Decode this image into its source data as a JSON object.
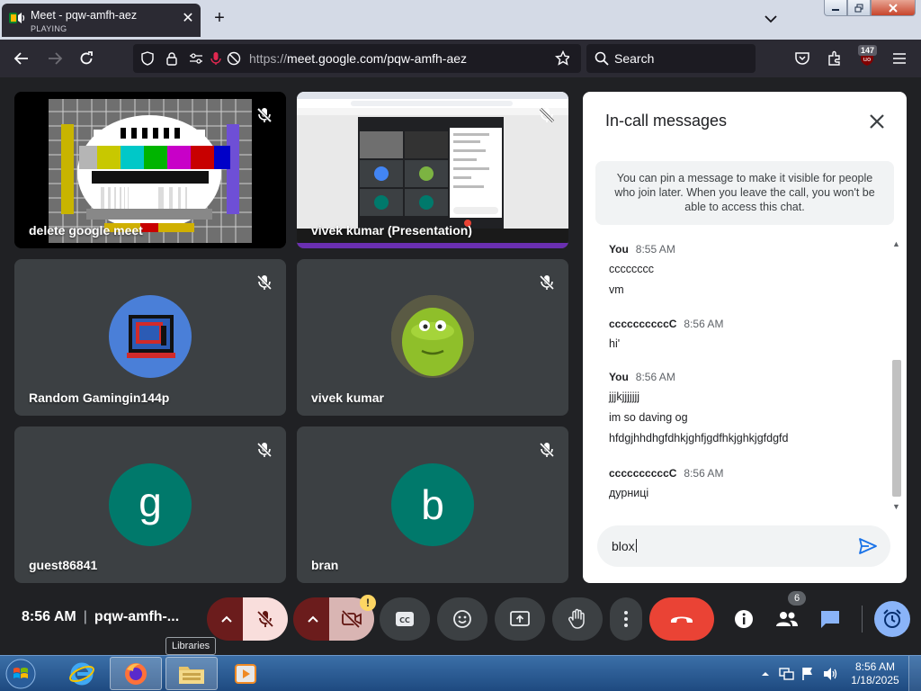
{
  "browser": {
    "tab": {
      "title": "Meet - pqw-amfh-aez",
      "subtitle": "PLAYING",
      "close_glyph": "✕"
    },
    "new_tab_glyph": "+",
    "url": {
      "prefix": "https://",
      "host_path": "meet.google.com/pqw-amfh-aez"
    },
    "search": {
      "placeholder": "Search"
    },
    "extension_badge": "147"
  },
  "tiles": [
    {
      "name": "delete google meet"
    },
    {
      "name": "vivek kumar (Presentation)"
    },
    {
      "name": "Random Gamingin144p"
    },
    {
      "name": "vivek kumar"
    },
    {
      "name": "guest86841",
      "initial": "g"
    },
    {
      "name": "bran",
      "initial": "b"
    }
  ],
  "chat": {
    "title": "In-call messages",
    "pin_note": "You can pin a message to make it visible for people who join later. When you leave the call, you won't be able to access this chat.",
    "groups": [
      {
        "sender": "You",
        "time": "8:55 AM",
        "lines": [
          "cccccccc",
          "vm"
        ]
      },
      {
        "sender": "ccccccccccC",
        "time": "8:56 AM",
        "lines": [
          "hi'"
        ]
      },
      {
        "sender": "You",
        "time": "8:56 AM",
        "lines": [
          "jjjkjjjjjjj",
          "im so daving og",
          "hfdgjhhdhgfdhkjghfjgdfhkjghkjgfdgfd"
        ]
      },
      {
        "sender": "ccccccccccC",
        "time": "8:56 AM",
        "lines": [
          "дурниці"
        ]
      }
    ],
    "input_value": "blox"
  },
  "controls": {
    "time": "8:56 AM",
    "separator": "|",
    "meeting_code": "pqw-amfh-...",
    "tooltip": "Libraries",
    "people_count": "6",
    "camera_warning": "!"
  },
  "taskbar": {
    "clock_time": "8:56 AM",
    "clock_date": "1/18/2025"
  },
  "colors": {
    "meet_bg": "#202124",
    "tile_bg": "#3c4043",
    "end_call": "#ea4335",
    "accent_blue": "#8ab4f8",
    "avatar_teal": "#00796b",
    "avatar_blue": "#4285f4"
  }
}
